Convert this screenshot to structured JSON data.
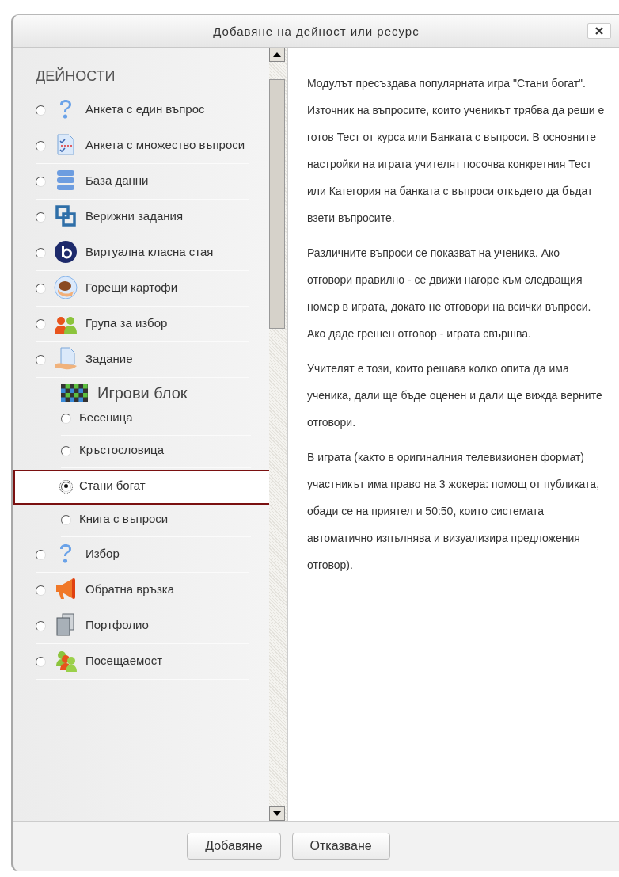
{
  "dialog": {
    "title": "Добавяне на дейност или ресурс"
  },
  "activities": {
    "heading": "ДЕЙНОСТИ",
    "items": [
      {
        "kind": "module",
        "label": "Анкета с един въпрос",
        "selected": false
      },
      {
        "kind": "module",
        "label": "Анкета с множество въпроси",
        "selected": false
      },
      {
        "kind": "module",
        "label": "База данни",
        "selected": false
      },
      {
        "kind": "module",
        "label": "Верижни задания",
        "selected": false
      },
      {
        "kind": "module",
        "label": "Виртуална класна стая",
        "selected": false
      },
      {
        "kind": "module",
        "label": "Горещи картофи",
        "selected": false
      },
      {
        "kind": "module",
        "label": "Група за избор",
        "selected": false
      },
      {
        "kind": "module",
        "label": "Задание",
        "selected": false
      },
      {
        "kind": "group",
        "label": "Игрови блок",
        "children": [
          {
            "label": "Бесеница",
            "selected": false
          },
          {
            "label": "Кръстословица",
            "selected": false
          },
          {
            "label": "Стани богат",
            "selected": true
          },
          {
            "label": "Книга с въпроси",
            "selected": false
          }
        ]
      },
      {
        "kind": "module",
        "label": "Избор",
        "selected": false
      },
      {
        "kind": "module",
        "label": "Обратна връзка",
        "selected": false
      },
      {
        "kind": "module",
        "label": "Портфолио",
        "selected": false
      },
      {
        "kind": "module",
        "label": "Посещаемост",
        "selected": false
      }
    ]
  },
  "description": {
    "paragraphs": [
      "Модулът пресъздава популярната игра \"Стани богат\". Източник на въпросите, които ученикът трябва да реши е готов Тест от курса или Банката с въпроси. В основните настройки на играта учителят посочва конкретния Тест или Категория на банката с въпроси откъдето да бъдат взети въпросите.",
      "Различните въпроси се показват на ученика. Ако отговори правилно - се движи нагоре към следващия номер в играта, докато не отговори на всички въпроси. Ако даде грешен отговор - играта свършва.",
      "Учителят е този, които решава колко опита да има ученика, дали ще бъде оценен и дали ще вижда верните отговори.",
      "В играта (както в оригиналния телевизионен формат) участникът има право на 3 жокера: помощ от публиката, обади се на приятел и 50:50, които системата автоматично изпълнява и визуализира предложения отговор)."
    ]
  },
  "buttons": [
    "Добавяне",
    "Отказване"
  ]
}
